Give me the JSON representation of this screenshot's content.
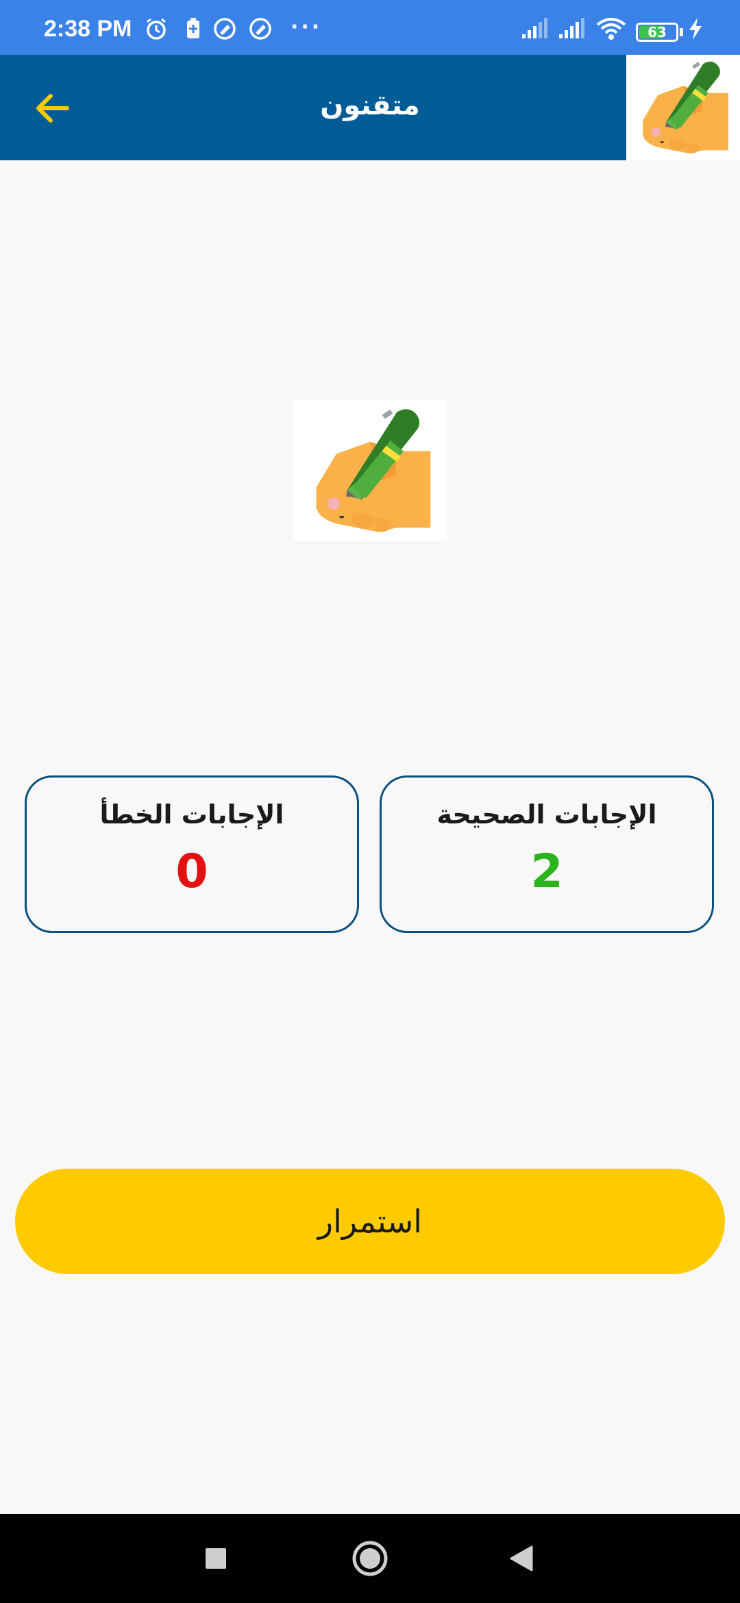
{
  "status_bar": {
    "time": "2:38 PM",
    "battery_level": "63",
    "icons": [
      "alarm-icon",
      "battery-saver-icon",
      "app-notification-icon",
      "app-notification-icon",
      "more-dots-icon",
      "signal-icon",
      "signal-icon",
      "wifi-icon",
      "battery-icon",
      "charging-icon"
    ],
    "more": "···"
  },
  "app_bar": {
    "title": "متقنون",
    "back_icon": "arrow-left-icon",
    "accent_color": "#fecb00",
    "background_color": "#045c96"
  },
  "hero": {
    "image": "hand-writing-pen-icon"
  },
  "scores": {
    "correct": {
      "label": "الإجابات الصحيحة",
      "value": "2",
      "color": "#2ab31a"
    },
    "wrong": {
      "label": "الإجابات الخطأ",
      "value": "0",
      "color": "#e21212"
    }
  },
  "continue_button": {
    "label": "استمرار",
    "color": "#fecb00"
  },
  "nav_bar": {
    "buttons": [
      "recents-square-icon",
      "home-circle-icon",
      "back-triangle-icon"
    ]
  }
}
